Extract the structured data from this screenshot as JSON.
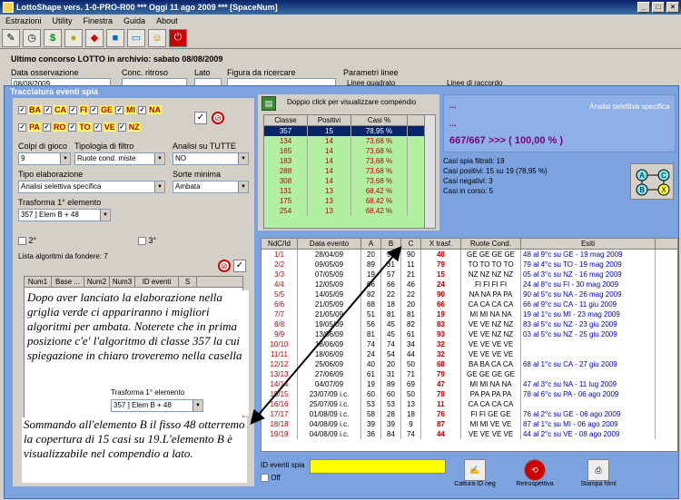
{
  "window": {
    "title": "LottoShape vers. 1-0-PRO-R00  ***  Oggi 11 ago 2009  ***  [SpaceNum]"
  },
  "menu": [
    "Estrazioni",
    "Utility",
    "Finestra",
    "Guida",
    "About"
  ],
  "header": {
    "title": "Ultimo concorso LOTTO in archivio: sabato 08/08/2009",
    "data_oss": "Data osservazione",
    "data_oss_val": "08/08/2009",
    "conc_ritroso": "Conc. ritroso",
    "lato": "Lato",
    "figura": "Figura da ricercare",
    "parametri": "Parametri linee",
    "linee_quadrato": "Linee quadrato",
    "linee_raccordo": "Linee di raccordo"
  },
  "tracciatura": {
    "title": "Tracciatura eventi spia",
    "ruote": [
      "BA",
      "CA",
      "FI",
      "GE",
      "MI",
      "NA",
      "PA",
      "RO",
      "TO",
      "VE",
      "NZ"
    ],
    "colpi_label": "Colpi di gioco",
    "colpi_val": "9",
    "tipologia_label": "Tipologia di filtro",
    "tipologia_val": "Ruote cond. miste",
    "analisi_label": "Analisi su TUTTE",
    "analisi_val": "NO",
    "tipo_label": "Tipo elaborazione",
    "tipo_val": "Analisi selettiva specifica",
    "sorte_label": "Sorte minima",
    "sorte_val": "Ambata",
    "trasforma_label": "Trasforma 1° elemento",
    "trasforma_val": "357 ] Elem B + 48",
    "second": "2°",
    "third": "3°",
    "lista_label": "Lista algoritmi da fondere: 7",
    "lista_cols": [
      "Num1",
      "Base ...",
      "Num2",
      "Num3",
      "ID eventi",
      "S"
    ]
  },
  "compendio": {
    "hint": "Doppio click per visualizzare compendio",
    "cols": [
      "Classe",
      "Positivi",
      "Casi %"
    ],
    "rows": [
      [
        "357",
        "15",
        "78,95 %"
      ],
      [
        "134",
        "14",
        "73,68 %"
      ],
      [
        "165",
        "14",
        "73,68 %"
      ],
      [
        "183",
        "14",
        "73,68 %"
      ],
      [
        "288",
        "14",
        "73,68 %"
      ],
      [
        "308",
        "14",
        "73,68 %"
      ],
      [
        "131",
        "13",
        "68,42 %"
      ],
      [
        "175",
        "13",
        "68,42 %"
      ],
      [
        "254",
        "13",
        "68,42 %"
      ]
    ]
  },
  "analisi": {
    "title": "Analisi selettiva specifica",
    "dots1": "...",
    "dots2": "...",
    "result": "667/667 >>> ( 100,00 % )",
    "spia": "Casi spia filtrati: 19",
    "positivi": "Casi positivi: 15 su 19 (78,95 %)",
    "negativi": "Casi negativi: 3",
    "in_corso": "Casi in corso: 5"
  },
  "eventi": {
    "cols": [
      "NdC/Id",
      "Data evento",
      "A",
      "B",
      "C",
      "X trasf.",
      "Ruote Cond.",
      "Esiti"
    ],
    "rows": [
      [
        "1/1",
        "28/04/09",
        "20",
        "90",
        "90",
        "48",
        "GE GE GE GE",
        "48 al 9°c su GE - 19 mag 2009"
      ],
      [
        "2/2",
        "09/05/09",
        "89",
        "31",
        "11",
        "79",
        "TO TO TO TO",
        "79 al 4°c su TO - 19 mag 2009"
      ],
      [
        "3/3",
        "07/05/09",
        "19",
        "57",
        "21",
        "15",
        "NZ NZ NZ NZ",
        "05 al 3°c su NZ - 16 mag 2009"
      ],
      [
        "4/4",
        "12/05/09",
        "66",
        "66",
        "46",
        "24",
        "FI FI FI FI",
        "24 al 8°c su FI - 30 mag 2009"
      ],
      [
        "5/5",
        "14/05/09",
        "82",
        "22",
        "22",
        "90",
        "NA NA PA PA",
        "90 al 5°c su NA - 26 mag 2009"
      ],
      [
        "6/6",
        "21/05/09",
        "68",
        "18",
        "20",
        "66",
        "CA CA CA CA",
        "66 al 9°c su CA - 11 giu 2009"
      ],
      [
        "7/7",
        "21/05/09",
        "51",
        "81",
        "81",
        "19",
        "MI MI NA NA",
        "19 al 1°c su MI - 23 mag 2009"
      ],
      [
        "8/8",
        "19/05/09",
        "56",
        "45",
        "82",
        "83",
        "VE VE NZ NZ",
        "83 al 5°c su NZ - 23 giu 2009"
      ],
      [
        "9/9",
        "13/06/09",
        "81",
        "45",
        "61",
        "93",
        "VE VE NZ NZ",
        "03 al 5°c su NZ - 25 giu 2009"
      ],
      [
        "10/10",
        "18/06/09",
        "74",
        "74",
        "34",
        "32",
        "VE VE VE VE",
        ""
      ],
      [
        "11/11",
        "18/06/09",
        "24",
        "54",
        "44",
        "32",
        "VE VE VE VE",
        ""
      ],
      [
        "12/12",
        "25/06/09",
        "40",
        "20",
        "50",
        "68",
        "BA BA CA CA",
        "68 al 1°c su CA - 27 giu 2009"
      ],
      [
        "13/13",
        "27/06/09",
        "61",
        "31",
        "71",
        "79",
        "GE GE GE GE",
        ""
      ],
      [
        "14/14",
        "04/07/09",
        "19",
        "89",
        "69",
        "47",
        "MI MI NA NA",
        "47 al 3°c su NA - 11 lug 2009"
      ],
      [
        "15/15",
        "23/07/09 i.c.",
        "60",
        "60",
        "50",
        "78",
        "PA PA PA PA",
        "78 al 6°c su PA - 06 ago 2009"
      ],
      [
        "16/16",
        "25/07/09 i.c.",
        "53",
        "53",
        "13",
        "11",
        "CA CA CA CA",
        ""
      ],
      [
        "17/17",
        "01/08/09 i.c.",
        "58",
        "28",
        "18",
        "76",
        "FI FI GE GE",
        "76 al 2°c su GE - 06 ago 2009"
      ],
      [
        "18/18",
        "04/08/09 i.c.",
        "39",
        "39",
        "9",
        "87",
        "MI MI VE VE",
        "87 al 1°c su MI - 06 ago 2009"
      ],
      [
        "19/19",
        "04/08/09 i.c.",
        "36",
        "84",
        "74",
        "44",
        "VE VE VE VE",
        "44 al 2°c su VE - 08 ago 2009"
      ]
    ]
  },
  "bottom": {
    "id_label": "ID eventi spia",
    "off": "Off",
    "cattura": "Cattura ID neg",
    "retro": "Retrospettiva",
    "stampa": "Stampa html"
  },
  "note": {
    "text1": "Dopo aver lanciato la elaborazione nella griglia verde ci appariranno i migliori algoritmi per ambata. Noterete che in prima posizione c'e' l'algoritmo di classe 357 la cui spiegazione in chiaro troveremo nella casella",
    "trasforma_label": "Trasforma 1° elemento",
    "trasforma_val": "357 ] Elem B + 48",
    "text2": "Sommando all'elemento B il fisso 48 otterremo la copertura di 15 casi su 19.L'elemento B è visualizzabile nel compendio a lato."
  },
  "diagram": {
    "a": "A",
    "b": "B",
    "c": "C",
    "x": "X"
  }
}
